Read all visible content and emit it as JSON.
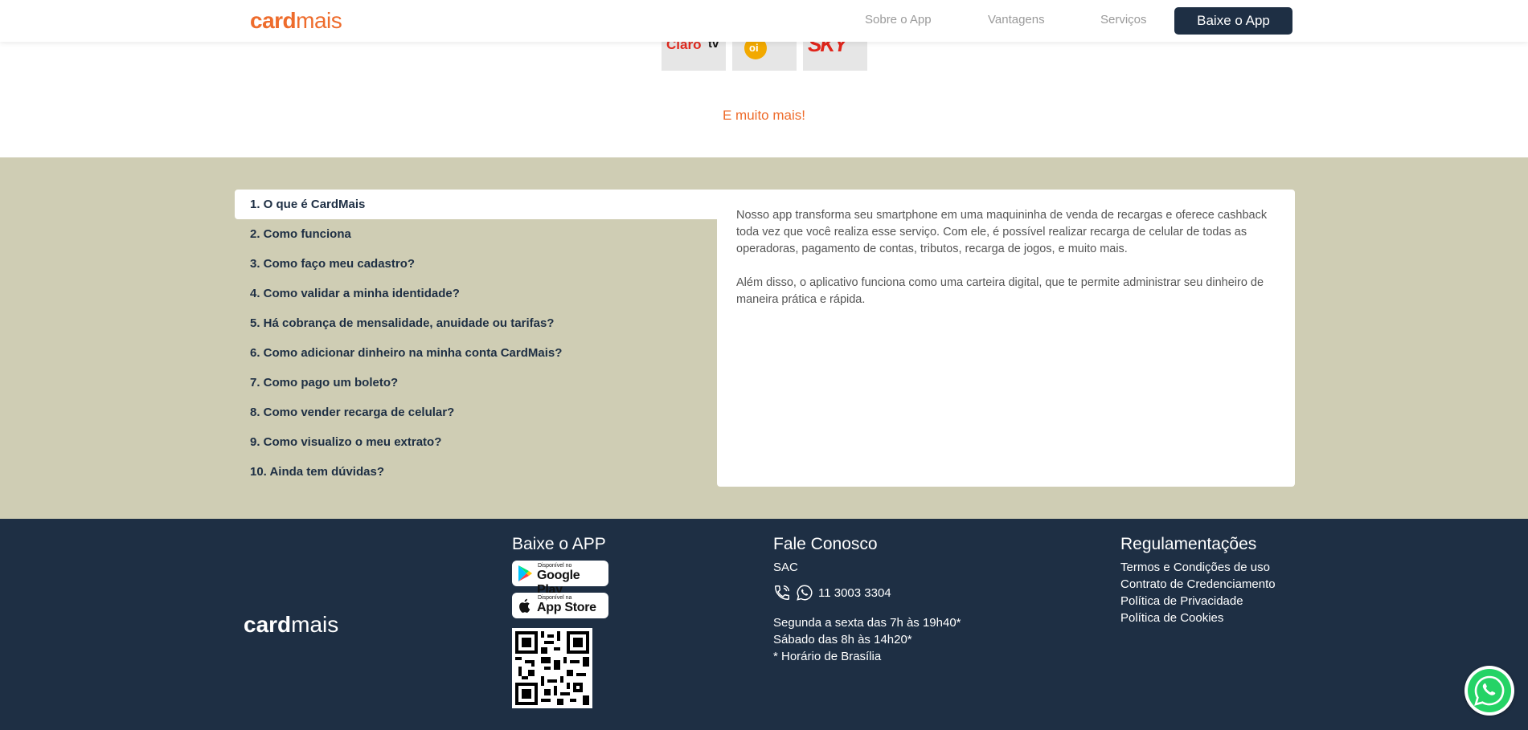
{
  "header": {
    "logo_bold": "card",
    "logo_light": "mais",
    "nav": [
      "Sobre o App",
      "Vantagens",
      "Serviços"
    ],
    "cta_label": "Baixe o App"
  },
  "operators": {
    "claro_text": "Claro",
    "claro_tv": "tv",
    "oi_text": "oi",
    "sky_text": "SKY"
  },
  "more_label": "E muito mais!",
  "faq": {
    "items": [
      "1. O que é CardMais",
      "2. Como funciona",
      "3. Como faço meu cadastro?",
      "4. Como validar a minha identidade?",
      "5. Há cobrança de mensalidade, anuidade ou tarifas?",
      "6. Como adicionar dinheiro na minha conta CardMais?",
      "7. Como pago um boleto?",
      "8. Como vender recarga de celular?",
      "9. Como visualizo o meu extrato?",
      "10. Ainda tem dúvidas?"
    ],
    "answer_p1": "Nosso app transforma seu smartphone em uma maquininha de venda de recargas e oferece cashback toda vez que você realiza esse serviço. Com ele, é possível realizar recarga de celular de todas as operadoras, pagamento de contas, tributos, recarga de jogos, e muito mais.",
    "answer_p2": "Além disso, o aplicativo funciona como uma carteira digital, que te permite administrar seu dinheiro de maneira prática e rápida."
  },
  "footer": {
    "logo_bold": "card",
    "logo_light": "mais",
    "download": {
      "title": "Baixe o APP",
      "google_small": "Disponível no",
      "google_big": "Google Play",
      "apple_small": "Disponível na",
      "apple_big": "App Store"
    },
    "contact": {
      "title": "Fale Conosco",
      "sac": "SAC",
      "phone": "11 3003 3304",
      "hours1": "Segunda a sexta das 7h às 19h40*",
      "hours2": "Sábado das 8h às 14h20*",
      "hours_note": "* Horário de Brasília"
    },
    "regulations": {
      "title": "Regulamentações",
      "links": [
        "Termos e Condições de uso",
        "Contrato de Credenciamento",
        "Política de Privacidade",
        "Política de Cookies"
      ]
    }
  },
  "colors": {
    "brand_orange": "#ee6c2c",
    "navy": "#1e2f44",
    "faq_bg": "#cfcdb4",
    "whatsapp_green": "#25d366"
  },
  "icons": [
    "phone-icon",
    "whatsapp-icon",
    "google-play-icon",
    "apple-icon",
    "qr-code"
  ]
}
